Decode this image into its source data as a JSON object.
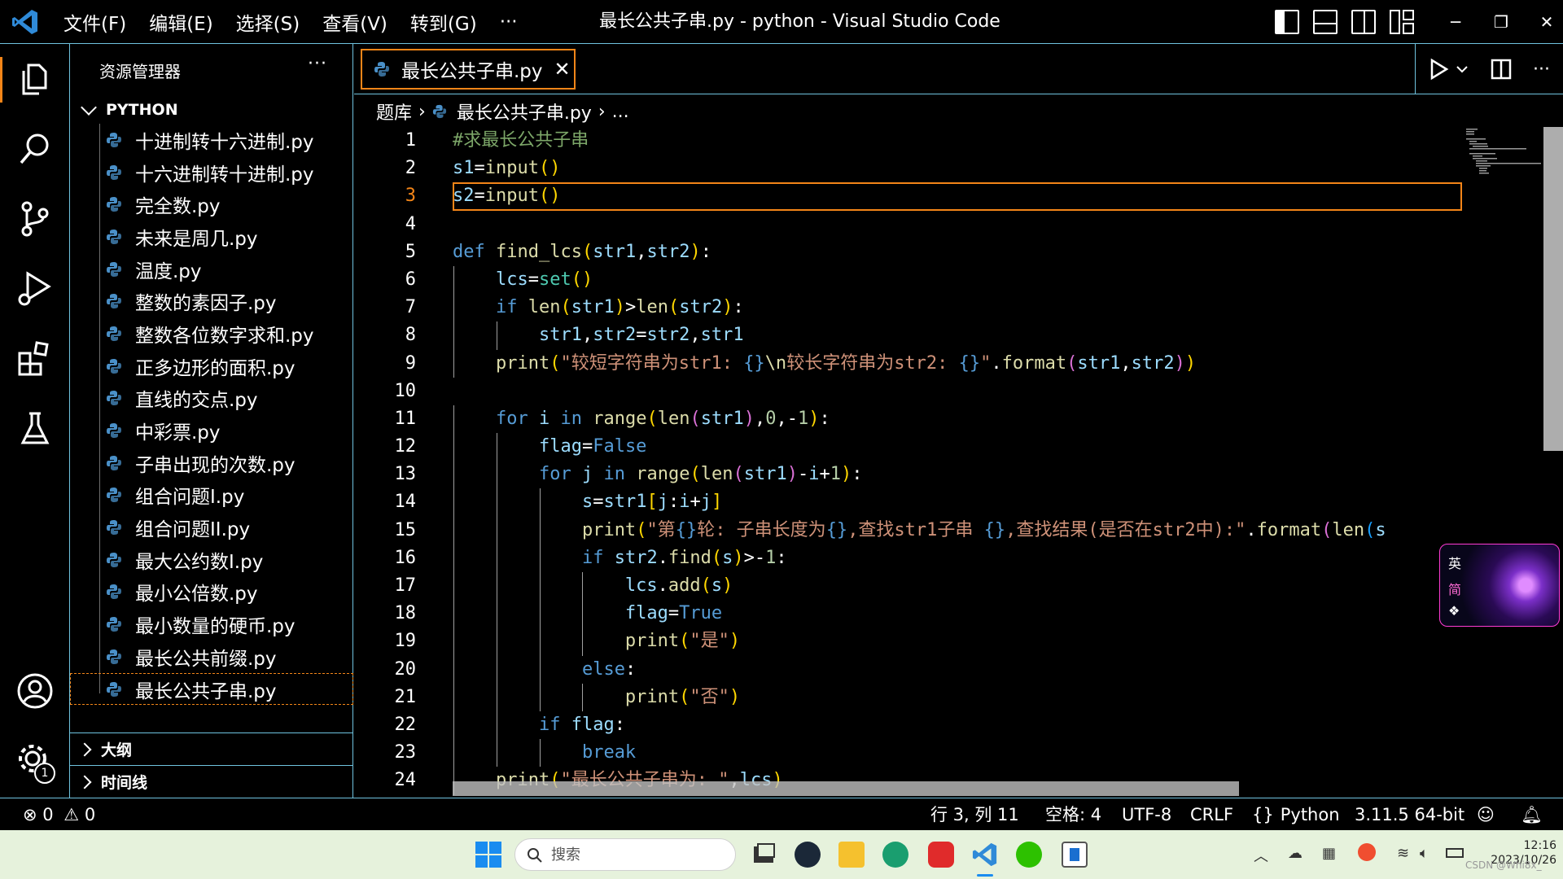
{
  "titlebar": {
    "menus": [
      "文件(F)",
      "编辑(E)",
      "选择(S)",
      "查看(V)",
      "转到(G)",
      "···"
    ],
    "title": "最长公共子串.py - python - Visual Studio Code"
  },
  "sidebar": {
    "title": "资源管理器",
    "more": "···",
    "section": "PYTHON",
    "files": [
      "十进制转十六进制.py",
      "十六进制转十进制.py",
      "完全数.py",
      "未来是周几.py",
      "温度.py",
      "整数的素因子.py",
      "整数各位数字求和.py",
      "正多边形的面积.py",
      "直线的交点.py",
      "中彩票.py",
      "子串出现的次数.py",
      "组合问题I.py",
      "组合问题II.py",
      "最大公约数I.py",
      "最小公倍数.py",
      "最小数量的硬币.py",
      "最长公共前缀.py",
      "最长公共子串.py"
    ],
    "active_index": 17,
    "outline": "大纲",
    "timeline": "时间线"
  },
  "tab": {
    "label": "最长公共子串.py",
    "close": "✕"
  },
  "breadcrumb": {
    "folder": "题库",
    "file": "最长公共子串.py",
    "more": "..."
  },
  "editor": {
    "current_line": 3,
    "line_numbers": [
      "1",
      "2",
      "3",
      "4",
      "5",
      "6",
      "7",
      "8",
      "9",
      "10",
      "11",
      "12",
      "13",
      "14",
      "15",
      "16",
      "17",
      "18",
      "19",
      "20",
      "21",
      "22",
      "23",
      "24"
    ],
    "lines": [
      "#求最长公共子串",
      "s1=input()",
      "s2=input()",
      "",
      "def find_lcs(str1,str2):",
      "    lcs=set()",
      "    if len(str1)>len(str2):",
      "        str1,str2=str2,str1",
      "    print(\"较短字符串为str1: {}\\n较长字符串为str2: {}\".format(str1,str2))",
      "",
      "    for i in range(len(str1),0,-1):",
      "        flag=False",
      "        for j in range(len(str1)-i+1):",
      "            s=str1[j:i+j]",
      "            print(\"第{}轮: 子串长度为{},查找str1子串 {},查找结果(是否在str2中):\".format(len(s",
      "            if str2.find(s)>-1:",
      "                lcs.add(s)",
      "                flag=True",
      "                print(\"是\")",
      "            else:",
      "                print(\"否\")",
      "        if flag:",
      "            break",
      "    print(\"最长公共子串为: \",lcs)"
    ]
  },
  "ime": {
    "lang": "英",
    "mode": "简"
  },
  "statusbar": {
    "errors": "0",
    "warnings": "0",
    "position": "行 3, 列 11",
    "spaces": "空格: 4",
    "encoding": "UTF-8",
    "eol": "CRLF",
    "language": "Python",
    "interpreter": "3.11.5 64-bit"
  },
  "activitybar": {
    "settings_badge": "1"
  },
  "taskbar": {
    "search_placeholder": "搜索",
    "time": "12:16",
    "date": "2023/10/26",
    "tray_ime": "",
    "watermark": "CSDN @Whi8x_"
  },
  "colors": {
    "accent_border": "#6fc3df",
    "focus_border": "#f38518",
    "comment": "#7ca668",
    "keyword": "#569cd6",
    "string": "#ce9178",
    "function": "#dcdcaa",
    "variable": "#9cdcfe"
  }
}
